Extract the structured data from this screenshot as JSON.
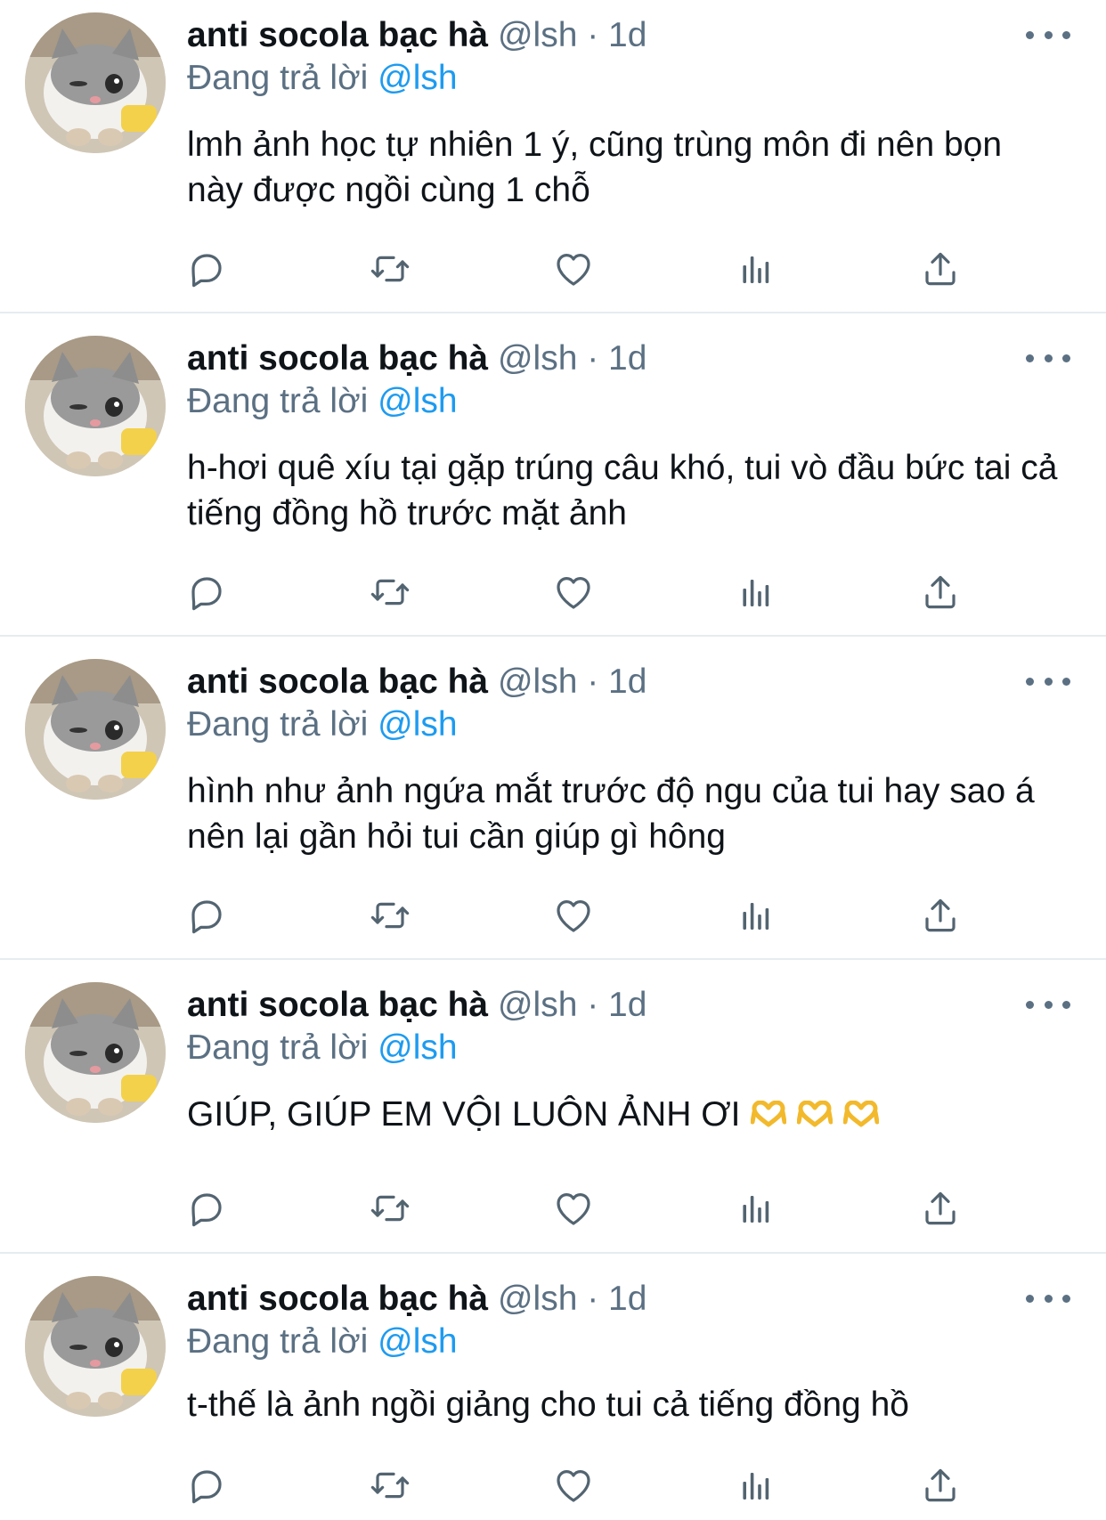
{
  "tweets": [
    {
      "display_name": "anti socola bạc hà",
      "meta": "@lsh · 1d",
      "replying_prefix": "Đang trả lời",
      "replying_handle": "@lsh",
      "text": "lmh ảnh học tự nhiên 1 ý, cũng trùng môn đi nên bọn này được ngồi cùng 1 chỗ"
    },
    {
      "display_name": "anti socola bạc hà",
      "meta": "@lsh · 1d",
      "replying_prefix": "Đang trả lời",
      "replying_handle": "@lsh",
      "text": "h-hơi quê xíu tại gặp trúng câu khó, tui vò đầu bức tai cả tiếng đồng hồ trước mặt ảnh"
    },
    {
      "display_name": "anti socola bạc hà",
      "meta": "@lsh · 1d",
      "replying_prefix": "Đang trả lời",
      "replying_handle": "@lsh",
      "text": "hình như ảnh ngứa mắt trước độ ngu của tui hay sao á nên lại gần hỏi tui cần giúp gì hông"
    },
    {
      "display_name": "anti socola bạc hà",
      "meta": "@lsh · 1d",
      "replying_prefix": "Đang trả lời",
      "replying_handle": "@lsh",
      "text": "GIÚP, GIÚP EM VỘI LUÔN ẢNH ƠI",
      "emojis": [
        "heart-hands-emoji",
        "heart-hands-emoji",
        "heart-hands-emoji"
      ]
    },
    {
      "display_name": "anti socola bạc hà",
      "meta": "@lsh · 1d",
      "replying_prefix": "Đang trả lời",
      "replying_handle": "@lsh",
      "text": "t-thế là ảnh ngồi giảng cho tui cả tiếng đồng hồ"
    }
  ],
  "icons": {
    "more": "more-horizontal-icon",
    "reply": "reply-icon",
    "retweet": "retweet-icon",
    "like": "like-heart-icon",
    "views": "analytics-icon",
    "share": "share-icon"
  },
  "colors": {
    "text": "#0f1419",
    "secondary": "#5b7083",
    "link": "#1d9bf0",
    "icon": "#536471",
    "divider": "#e6ecf0"
  }
}
